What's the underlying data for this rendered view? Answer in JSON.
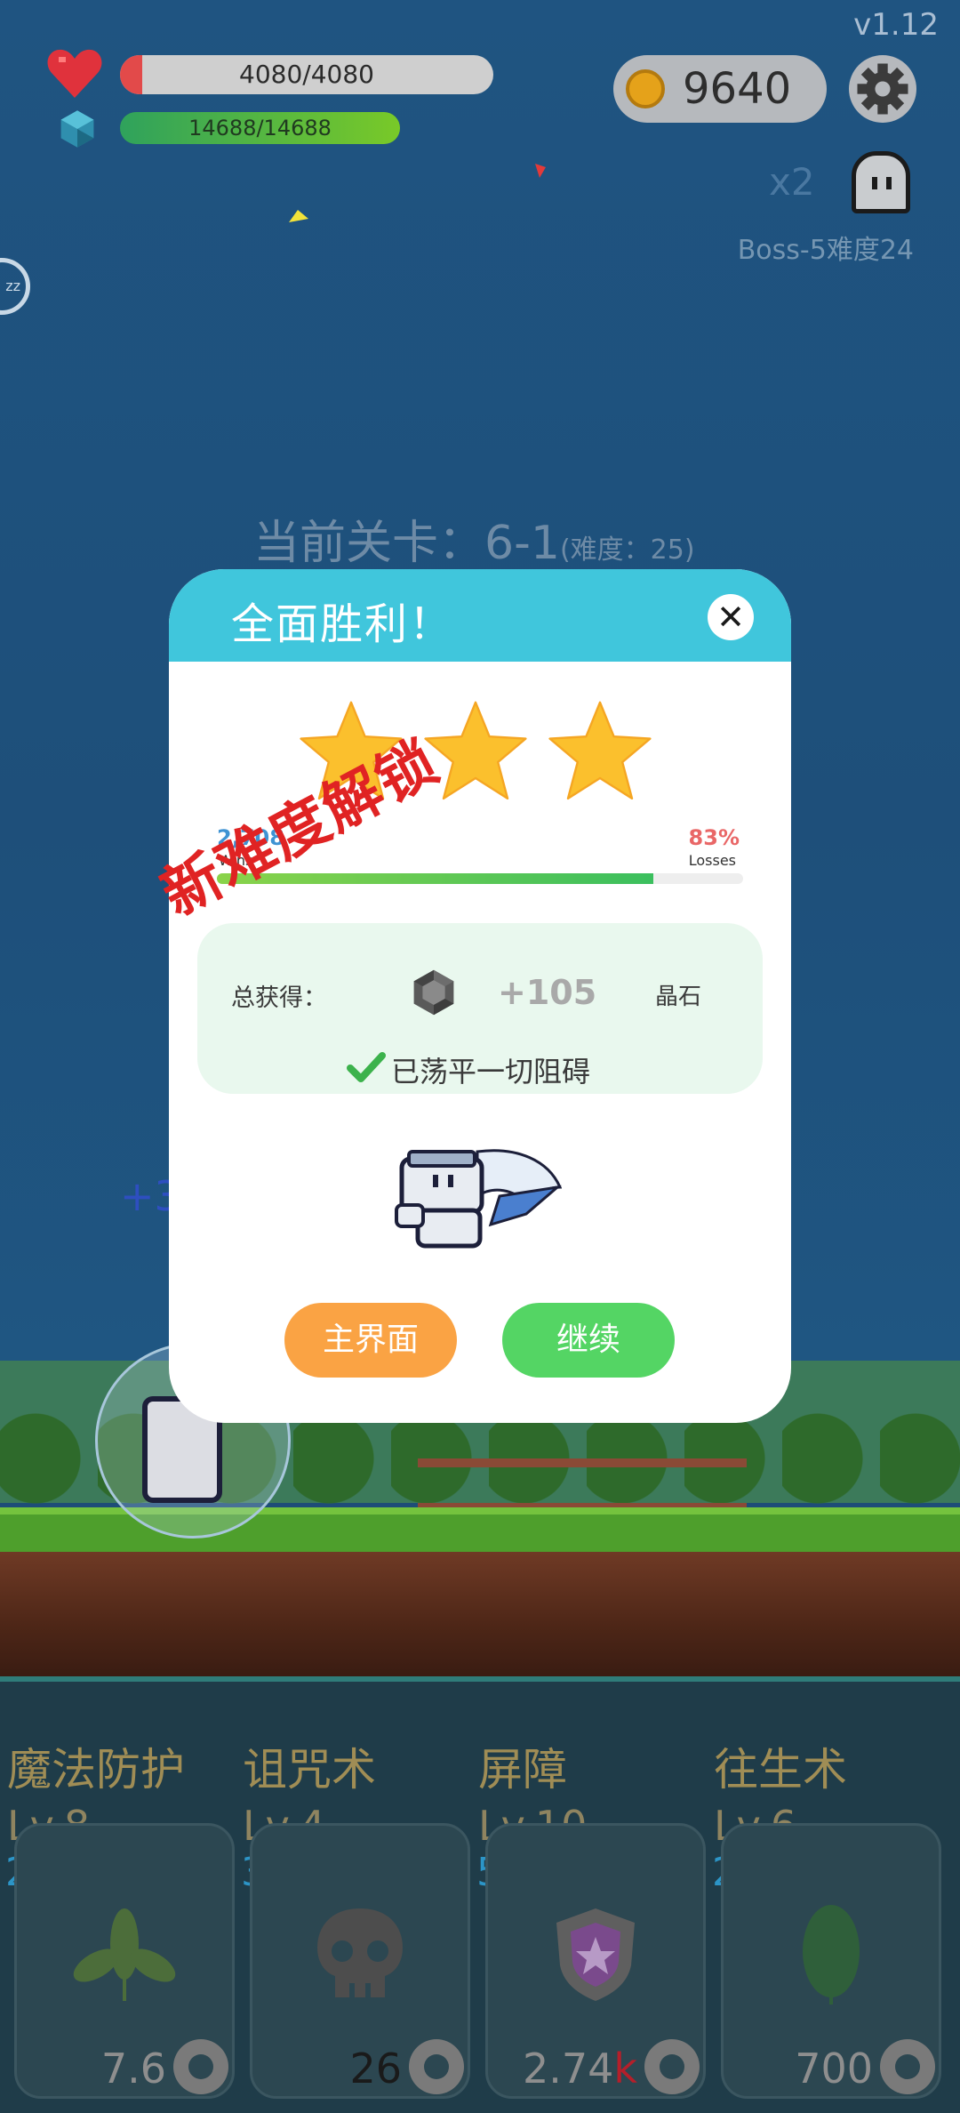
{
  "hud": {
    "version": "v1.12",
    "hp_text": "4080/4080",
    "hp_fraction": 1.0,
    "mp_text": "14688/14688",
    "mp_fraction": 1.0,
    "coins": "9640",
    "multiplier": "x2",
    "boss_label": "Boss-5难度24",
    "sleep_badge": "zz"
  },
  "stage": {
    "label": "当前关卡：6-1",
    "difficulty": "(难度：25)"
  },
  "floating_text": "+3",
  "modal": {
    "title": "全面胜利！",
    "close_symbol": "✕",
    "stars_earned": 3,
    "stars_total": 3,
    "wins_value": "2,708",
    "wins_label": "Wins",
    "losses_value": "83%",
    "losses_label": "Losses",
    "ratio_fraction": 0.83,
    "stamp_text": "新难度解锁",
    "reward_label": "总获得：",
    "reward_value": "+105",
    "reward_unit": "晶石",
    "cleared_text": "已荡平一切阻碍",
    "home_button": "主界面",
    "continue_button": "继续"
  },
  "skills": [
    {
      "name": "魔法防护",
      "level": "Lv.8",
      "cost": "20",
      "price": "7.6",
      "price_suffix": "",
      "icon": "sprout-icon"
    },
    {
      "name": "诅咒术",
      "level": "Lv.4",
      "cost": "30",
      "price": "26",
      "price_suffix": "",
      "icon": "skull-icon"
    },
    {
      "name": "屏障",
      "level": "Lv.10",
      "cost": "55",
      "price": "2.74",
      "price_suffix": "k",
      "icon": "shield-icon"
    },
    {
      "name": "往生术",
      "level": "Lv.6",
      "cost": "20",
      "price": "700",
      "price_suffix": "",
      "icon": "leaf-icon"
    }
  ],
  "colors": {
    "modal_header": "#40c6dc",
    "home_button": "#faa344",
    "continue_button": "#54d564",
    "stamp": "#e02323"
  }
}
